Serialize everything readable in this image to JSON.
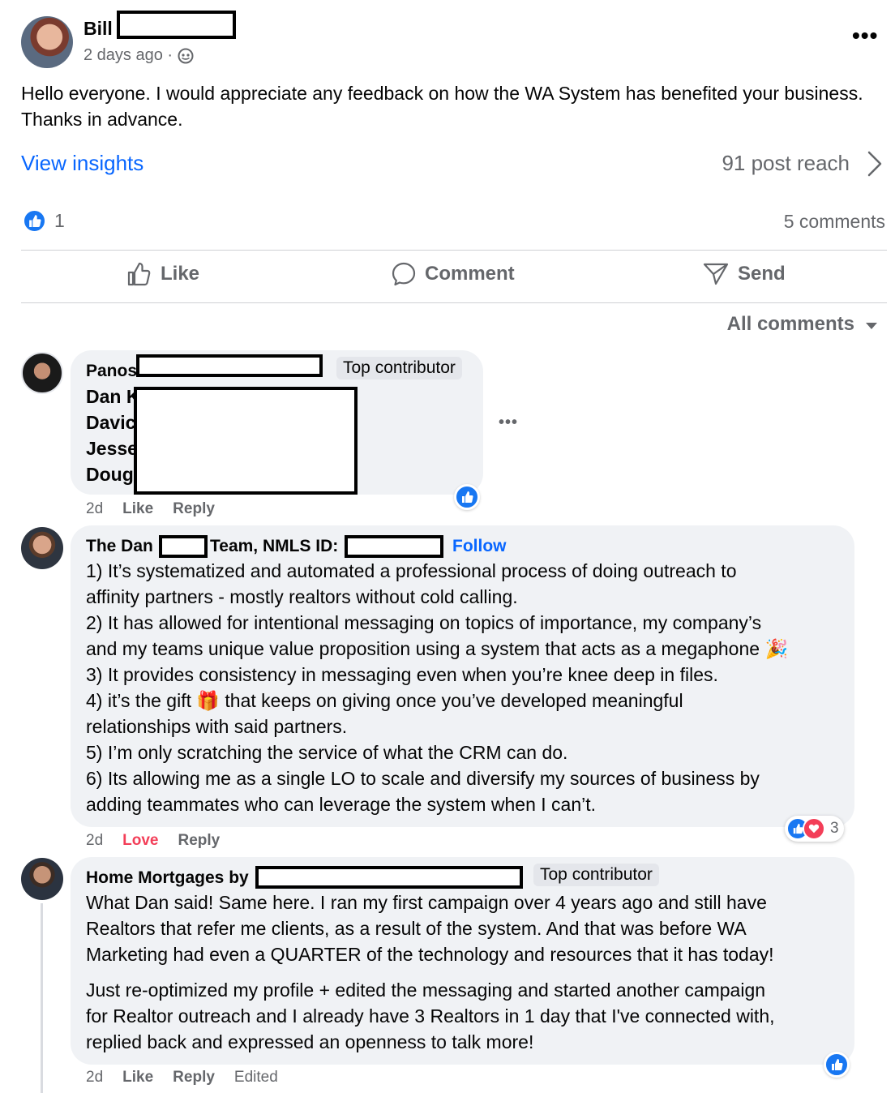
{
  "post": {
    "author": "Bill",
    "time": "2 days ago ·",
    "text": "Hello everyone. I would appreciate any feedback on how the WA System has benefited your business. Thanks in advance.",
    "insights_label": "View insights",
    "reach": "91 post reach",
    "reaction_count": "1",
    "comments_count": "5 comments"
  },
  "actions": {
    "like": "Like",
    "comment": "Comment",
    "send": "Send"
  },
  "sort": {
    "label": "All comments"
  },
  "comments": [
    {
      "name": "Panos",
      "badge": "Top contributor",
      "lines": [
        "Dan K",
        "Davic",
        "Jesse",
        "Doug"
      ],
      "time": "2d",
      "like": "Like",
      "reply": "Reply"
    },
    {
      "name_a": "The Dan",
      "name_b": "Team, NMLS ID:",
      "follow": "Follow",
      "body": [
        "1) It’s systematized and automated a professional process of doing outreach to",
        "affinity partners - mostly realtors without cold calling.",
        "2) It has allowed for intentional messaging on topics of importance, my company’s",
        "and my teams unique value proposition using a system that acts as a megaphone",
        "3) It provides consistency in messaging even when you’re knee deep in files.",
        "4) it’s the gift",
        "that keeps on giving once you’ve developed meaningful",
        "relationships with said partners.",
        "5) I’m only scratching the service of what the CRM can do.",
        "6) Its allowing me as a single LO to scale and diversify my sources of business by",
        "adding teammates who can leverage the system when I can’t."
      ],
      "time": "2d",
      "love": "Love",
      "reply": "Reply",
      "reaction_count": "3"
    },
    {
      "name": "Home Mortgages by",
      "badge": "Top contributor",
      "para1": [
        "What Dan said! Same here. I ran my first campaign over 4 years ago and still have",
        "Realtors that refer me clients, as a result of the system. And that was before WA",
        "Marketing had even a QUARTER of the technology and resources that it has today!"
      ],
      "para2": [
        "Just re-optimized my profile + edited the messaging and started another campaign",
        "for Realtor outreach and I already have 3 Realtors in 1 day that I've connected with,",
        "replied back and expressed an openness to talk more!"
      ],
      "time": "2d",
      "like": "Like",
      "reply": "Reply",
      "edited": "Edited"
    }
  ],
  "icons": {
    "privacy": "globe-icon",
    "more": "more-icon",
    "chevron": "chevron-right-icon",
    "like": "thumbs-up-icon",
    "comment": "comment-bubble-icon",
    "send": "send-icon",
    "love": "heart-icon",
    "gift": "gift-icon",
    "megaphone": "party-popper-icon"
  },
  "colors": {
    "link": "#0866ff",
    "like": "#1877f2",
    "love": "#f33e58",
    "muted": "#65676b",
    "bubble": "#f0f2f5"
  }
}
